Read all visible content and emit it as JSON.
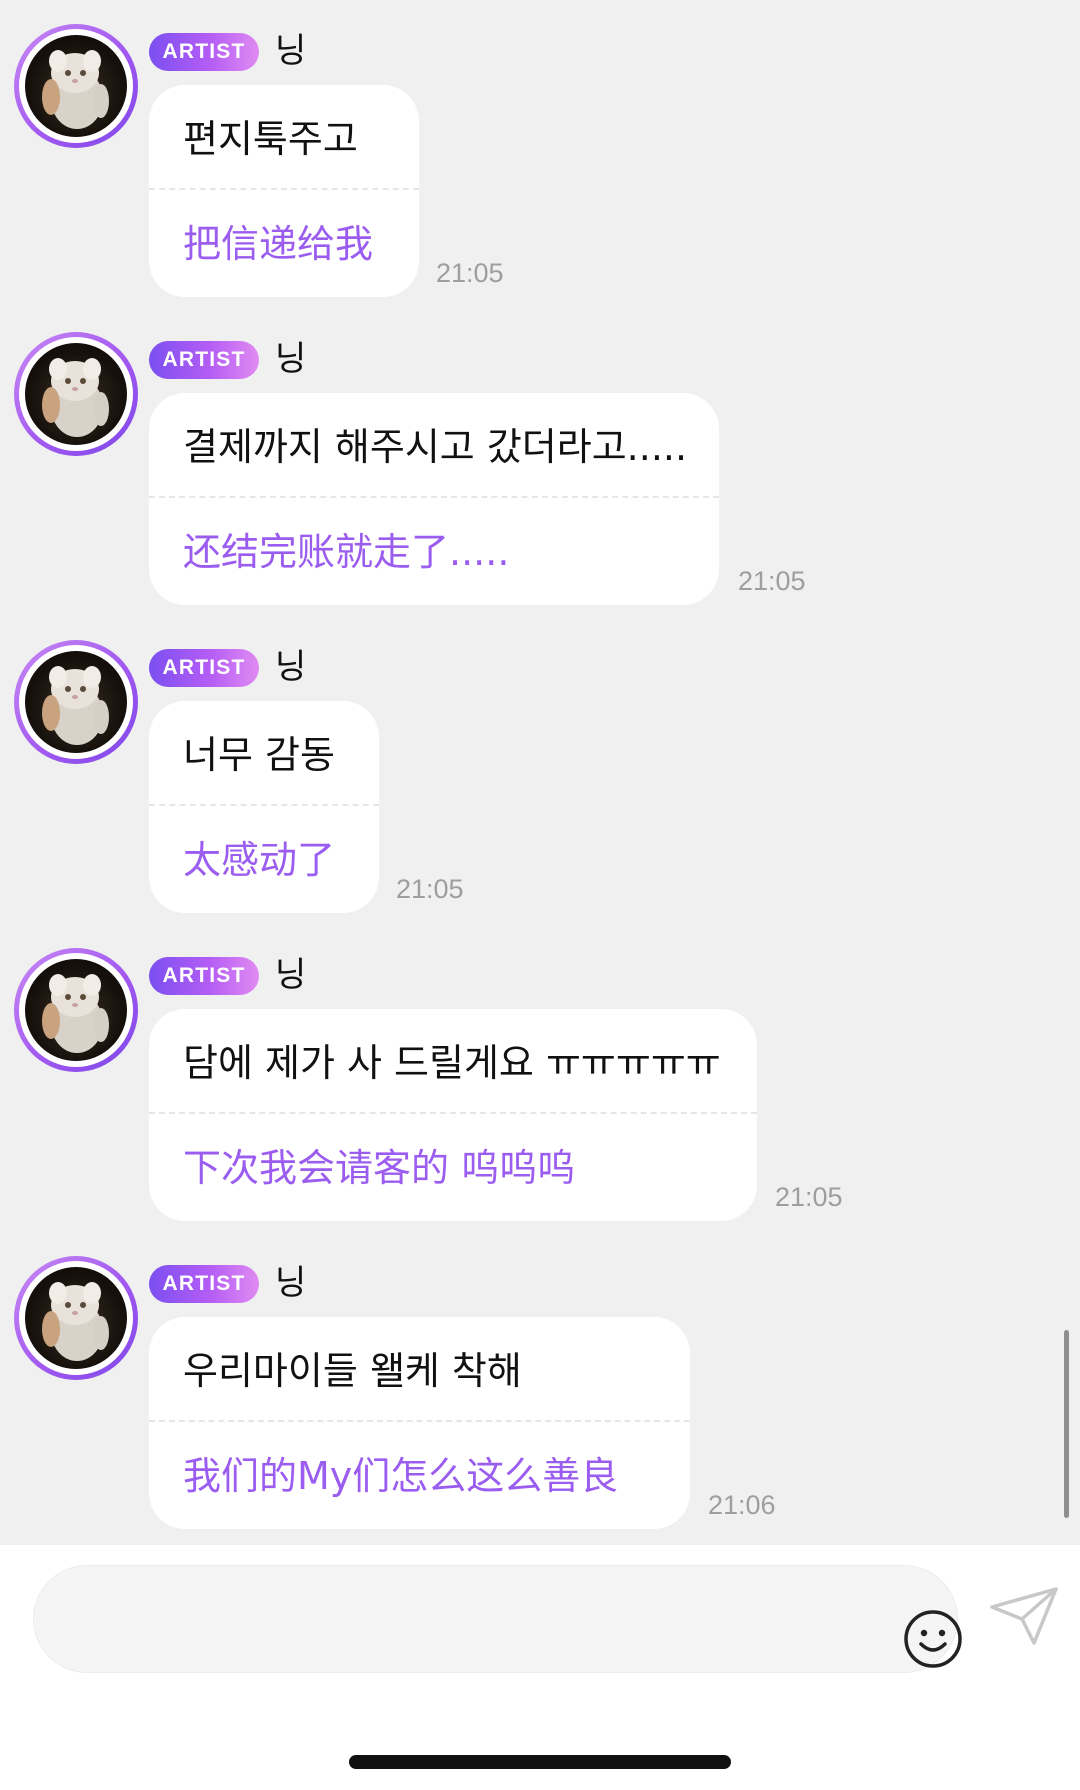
{
  "messages": [
    {
      "badge": "ARTIST",
      "sender": "닝",
      "original": "편지툭주고",
      "translation": "把信递给我",
      "time": "21:05"
    },
    {
      "badge": "ARTIST",
      "sender": "닝",
      "original": "결제까지 해주시고 갔더라고.....",
      "translation": "还结完账就走了.....",
      "time": "21:05"
    },
    {
      "badge": "ARTIST",
      "sender": "닝",
      "original": "너무 감동",
      "translation": "太感动了",
      "time": "21:05"
    },
    {
      "badge": "ARTIST",
      "sender": "닝",
      "original": "담에 제가 사 드릴게요 ㅠㅠㅠㅠㅠ",
      "translation": "下次我会请客的 呜呜呜",
      "time": "21:05"
    },
    {
      "badge": "ARTIST",
      "sender": "닝",
      "original": "우리마이들 왤케 착해",
      "translation": "我们的My们怎么这么善良",
      "time": "21:06"
    }
  ],
  "composer": {
    "placeholder": "",
    "emoji_icon": "smiley-icon",
    "send_icon": "paper-plane-send-icon"
  },
  "colors": {
    "translation": "#9b5cf0",
    "badge_start": "#7b4ff0",
    "badge_end": "#e08bf2",
    "avatar_ring": "#a259f0"
  }
}
